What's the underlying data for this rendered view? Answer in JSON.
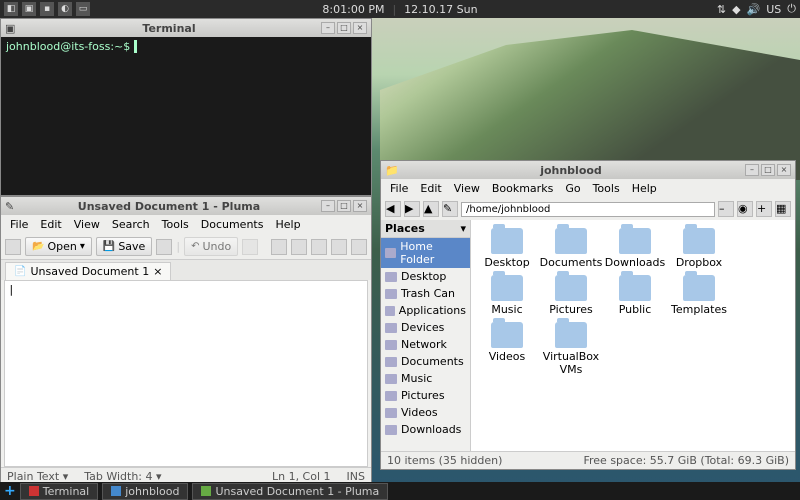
{
  "panel": {
    "time": "8:01:00 PM",
    "date": "12.10.17 Sun",
    "kbd": "US"
  },
  "terminal": {
    "title": "Terminal",
    "prompt": "johnblood@its-foss:~$ "
  },
  "pluma": {
    "title": "Unsaved Document 1 - Pluma",
    "menus": [
      "File",
      "Edit",
      "View",
      "Search",
      "Tools",
      "Documents",
      "Help"
    ],
    "open": "Open",
    "save": "Save",
    "undo": "Undo",
    "tab": "Unsaved Document 1",
    "status_mode": "Plain Text ▾",
    "status_tab": "Tab Width: 4 ▾",
    "status_pos": "Ln 1, Col 1",
    "status_ins": "INS"
  },
  "caja": {
    "title": "johnblood",
    "menus": [
      "File",
      "Edit",
      "View",
      "Bookmarks",
      "Go",
      "Tools",
      "Help"
    ],
    "path": "/home/johnblood",
    "places_label": "Places",
    "sidebar": [
      "Home Folder",
      "Desktop",
      "Trash Can",
      "Applications",
      "Devices",
      "Network",
      "Documents",
      "Music",
      "Pictures",
      "Videos",
      "Downloads"
    ],
    "sidebar_selected": 0,
    "folders": [
      "Desktop",
      "Documents",
      "Downloads",
      "Dropbox",
      "Music",
      "Pictures",
      "Public",
      "Templates",
      "Videos",
      "VirtualBox VMs"
    ],
    "status_left": "10 items (35 hidden)",
    "status_right": "Free space: 55.7 GiB (Total: 69.3 GiB)"
  },
  "taskbar": {
    "items": [
      "Terminal",
      "johnblood",
      "Unsaved Document 1 - Pluma"
    ]
  }
}
